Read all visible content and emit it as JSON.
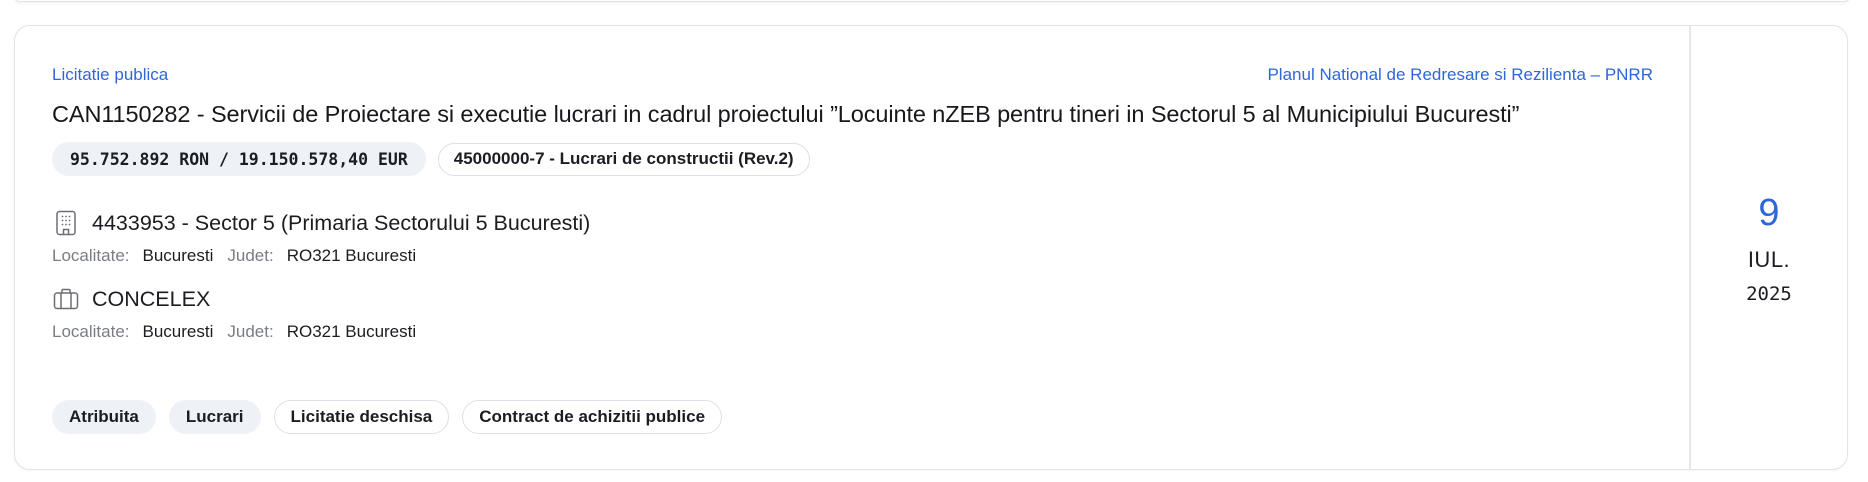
{
  "notice": {
    "procedure_type": "Licitatie publica",
    "funding_source": "Planul National de Redresare si Rezilienta – PNRR",
    "title": "CAN1150282 - Servicii de Proiectare si executie lucrari in cadrul proiectului ”Locuinte nZEB pentru tineri in Sectorul 5 al Municipiului Bucuresti”",
    "value": "95.752.892 RON / 19.150.578,40 EUR",
    "cpv": "45000000-7 - Lucrari de constructii (Rev.2)"
  },
  "authority": {
    "icon": "building-icon",
    "name": "4433953 - Sector 5 (Primaria Sectorului 5 Bucuresti)",
    "locality_label": "Localitate:",
    "locality": "Bucuresti",
    "county_label": "Judet:",
    "county": "RO321 Bucuresti"
  },
  "winner": {
    "icon": "briefcase-icon",
    "name": "CONCELEX",
    "locality_label": "Localitate:",
    "locality": "Bucuresti",
    "county_label": "Judet:",
    "county": "RO321 Bucuresti"
  },
  "tags": {
    "status": "Atribuita",
    "category": "Lucrari",
    "procedure": "Licitatie deschisa",
    "contract_type": "Contract de achizitii publice"
  },
  "date": {
    "day": "9",
    "month": "IUL.",
    "year": "2025"
  },
  "colors": {
    "accent": "#2f66d8",
    "chip_bg": "#eef1f6",
    "border": "#e1e3e8",
    "muted_text": "#7a7d85"
  }
}
